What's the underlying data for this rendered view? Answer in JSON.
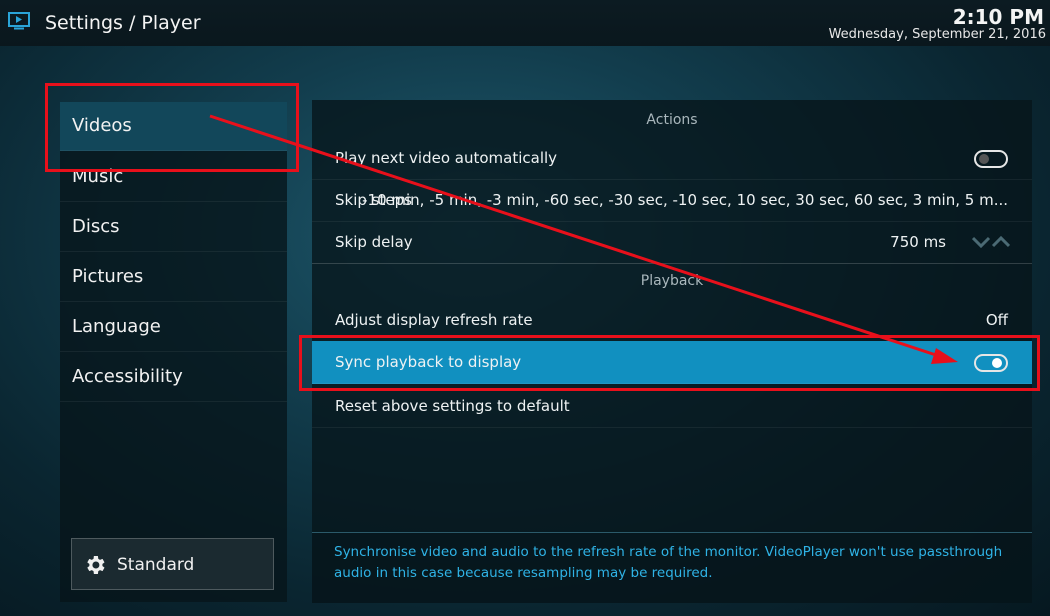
{
  "header": {
    "title": "Settings / Player",
    "time": "2:10 PM",
    "date": "Wednesday, September 21, 2016"
  },
  "sidebar": {
    "items": [
      {
        "label": "Videos"
      },
      {
        "label": "Music"
      },
      {
        "label": "Discs"
      },
      {
        "label": "Pictures"
      },
      {
        "label": "Language"
      },
      {
        "label": "Accessibility"
      }
    ],
    "level_button": "Standard"
  },
  "sections": {
    "actions": "Actions",
    "playback": "Playback"
  },
  "settings": {
    "play_next": {
      "label": "Play next video automatically",
      "enabled": false
    },
    "skip_steps": {
      "label": "Skip steps",
      "value": "-10 min, -5 min, -3 min, -60 sec, -30 sec, -10 sec, 10 sec, 30 sec, 60 sec, 3 min, 5 m..."
    },
    "skip_delay": {
      "label": "Skip delay",
      "value": "750 ms"
    },
    "refresh_rate": {
      "label": "Adjust display refresh rate",
      "value": "Off"
    },
    "sync_playback": {
      "label": "Sync playback to display",
      "enabled": true
    },
    "reset": {
      "label": "Reset above settings to default"
    }
  },
  "description": "Synchronise video and audio to the refresh rate of the monitor. VideoPlayer won't use passthrough audio in this case because resampling may be required.",
  "colors": {
    "accent": "#1190c0",
    "annotation": "#e8101b",
    "description_text": "#2fb3e6"
  }
}
